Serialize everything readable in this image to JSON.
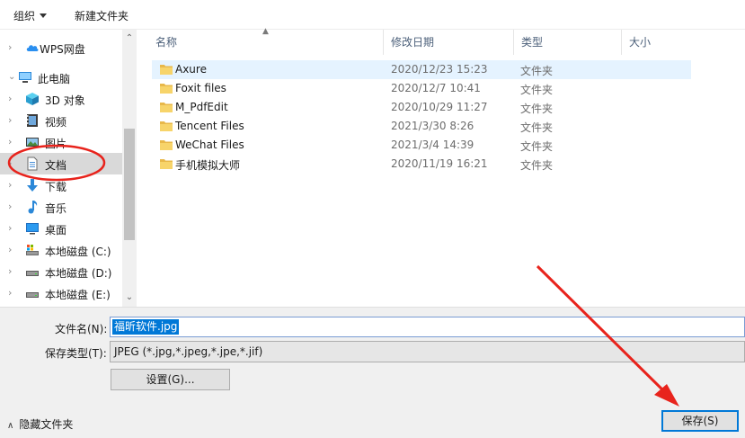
{
  "toolbar": {
    "organize": "组织",
    "new_folder": "新建文件夹"
  },
  "nav": {
    "items": [
      {
        "label": "WPS网盘",
        "icon": "cloud-icon"
      },
      {
        "label": "此电脑",
        "icon": "computer-icon"
      },
      {
        "label": "3D 对象",
        "icon": "cube-icon"
      },
      {
        "label": "视频",
        "icon": "video-icon"
      },
      {
        "label": "图片",
        "icon": "picture-icon"
      },
      {
        "label": "文档",
        "icon": "document-icon"
      },
      {
        "label": "下载",
        "icon": "download-icon"
      },
      {
        "label": "音乐",
        "icon": "music-icon"
      },
      {
        "label": "桌面",
        "icon": "desktop-icon"
      },
      {
        "label": "本地磁盘 (C:)",
        "icon": "drive-icon"
      },
      {
        "label": "本地磁盘 (D:)",
        "icon": "drive-icon"
      },
      {
        "label": "本地磁盘 (E:)",
        "icon": "drive-icon"
      }
    ]
  },
  "columns": {
    "name": "名称",
    "date": "修改日期",
    "type": "类型",
    "size": "大小"
  },
  "files": [
    {
      "name": "Axure",
      "date": "2020/12/23 15:23",
      "type": "文件夹"
    },
    {
      "name": "Foxit files",
      "date": "2020/12/7 10:41",
      "type": "文件夹"
    },
    {
      "name": "M_PdfEdit",
      "date": "2020/10/29 11:27",
      "type": "文件夹"
    },
    {
      "name": "Tencent Files",
      "date": "2021/3/30 8:26",
      "type": "文件夹"
    },
    {
      "name": "WeChat Files",
      "date": "2021/3/4 14:39",
      "type": "文件夹"
    },
    {
      "name": "手机模拟大师",
      "date": "2020/11/19 16:21",
      "type": "文件夹"
    }
  ],
  "form": {
    "filename_label": "文件名(N):",
    "filename_value": "福昕软件.jpg",
    "filetype_label": "保存类型(T):",
    "filetype_value": "JPEG (*.jpg,*.jpeg,*.jpe,*.jif)",
    "settings_button": "设置(G)...",
    "save_button": "保存(S)",
    "hide_folders": "隐藏文件夹"
  },
  "colors": {
    "selection": "#0078d7",
    "annotation": "#e8231c",
    "folder": "#f7d46a"
  }
}
